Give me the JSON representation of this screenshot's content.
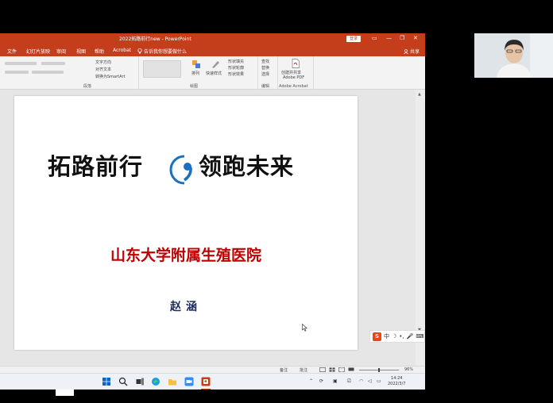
{
  "window": {
    "title": "2022拓路前行new - PowerPoint",
    "signin_label": "登录",
    "controls": [
      "▭",
      "—",
      "❐",
      "✕"
    ]
  },
  "tabs": [
    {
      "label": "文件"
    },
    {
      "label": "幻灯片放映"
    },
    {
      "label": "审阅"
    },
    {
      "label": "视图"
    },
    {
      "label": "帮助"
    },
    {
      "label": "Acrobat"
    }
  ],
  "tell_me": "告诉我你想要做什么",
  "share_label": "共享",
  "ribbon": {
    "groups": [
      {
        "label": "段落"
      },
      {
        "label": "绘图"
      },
      {
        "label": "编辑"
      },
      {
        "label": "Adobe Acrobat"
      }
    ],
    "items": {
      "text_direction": "文字方向",
      "align_text": "对齐文本",
      "convert_smartart": "转换为SmartArt",
      "arrange": "排列",
      "quick_styles": "快速样式",
      "shape_fill": "形状填充",
      "shape_outline": "形状轮廓",
      "shape_effects": "形状效果",
      "find": "查找",
      "replace": "替换",
      "select": "选择",
      "create_share": "创建并共享",
      "adobe_pdf": "Adobe PDF"
    }
  },
  "slide": {
    "slogan_left": "拓路前行",
    "slogan_right": "领跑未来",
    "hospital": "山东大学附属生殖医院",
    "presenter": "赵涵"
  },
  "ime": {
    "logo": "S",
    "mode": "中"
  },
  "status": {
    "notes": "备注",
    "comments": "批注",
    "zoom": "96%"
  },
  "clock": {
    "time": "14:24",
    "date": "2022/3/7"
  },
  "colors": {
    "accent": "#c43e1c",
    "hospital_text": "#c00000",
    "presenter_text": "#1f2d5c",
    "logo_blue": "#1a6fbf"
  }
}
